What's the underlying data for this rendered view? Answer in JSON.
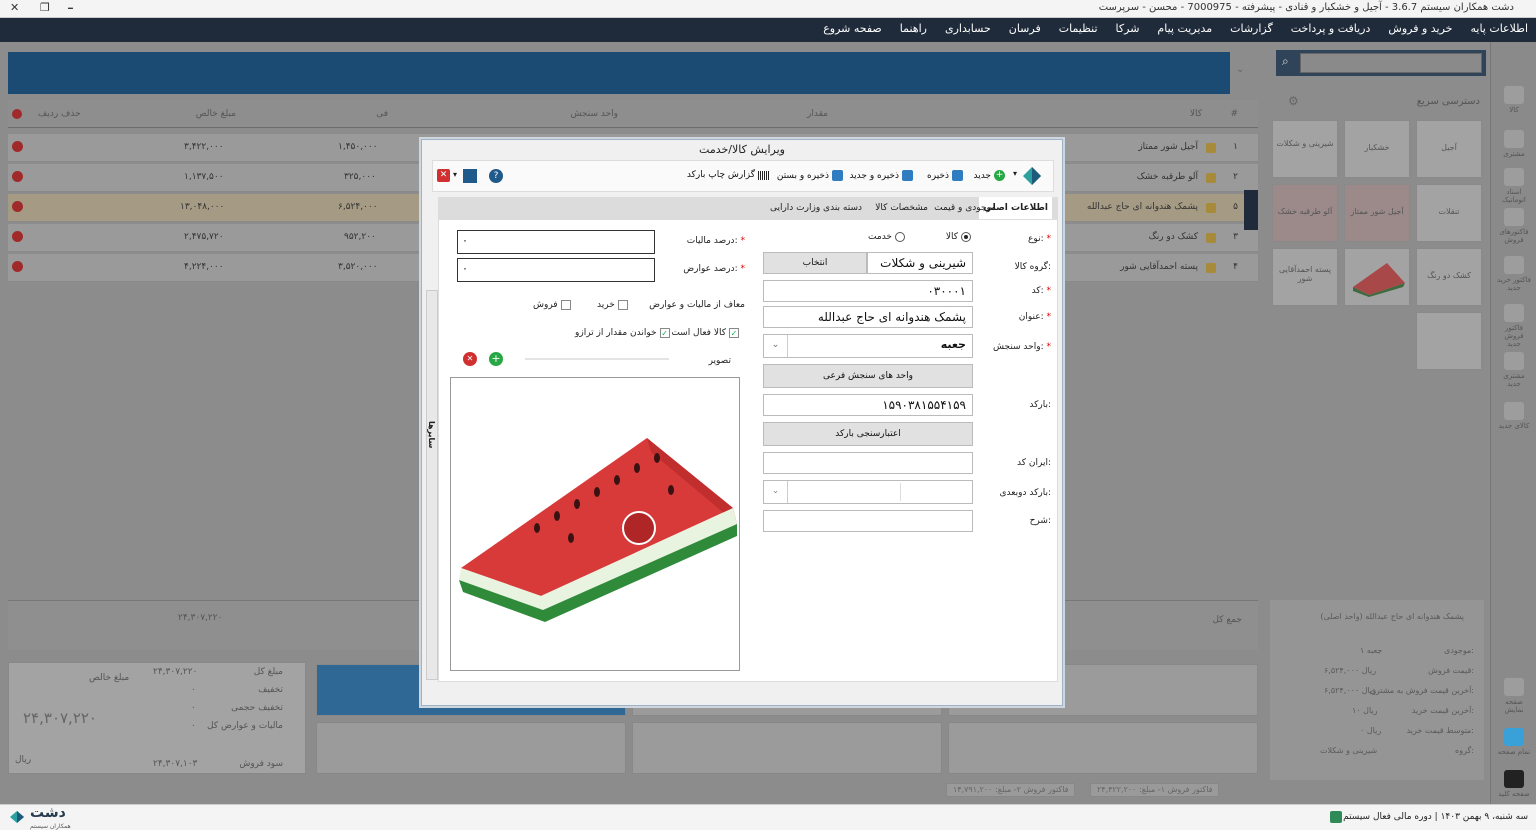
{
  "window": {
    "title": "دشت همکاران سیستم 3.6.7 - آجیل و خشکبار و قنادی - پیشرفته - 7000975 - محسن - سرپرست",
    "close": "✕",
    "restore": "❐",
    "minimize": "━"
  },
  "menu": [
    "اطلاعات پایه",
    "خرید و فروش",
    "دریافت و پرداخت",
    "گزارشات",
    "مدیریت پیام",
    "شرکا",
    "تنظیمات",
    "فرسان",
    "حسابداری",
    "راهنما",
    "صفحه شروع"
  ],
  "grid": {
    "headers": {
      "index": "#",
      "item": "کالا",
      "qty": "مقدار",
      "unit": "واحد سنجش",
      "fee": "فی",
      "net": "مبلغ خالص",
      "del": "حذف ردیف"
    },
    "rows": [
      {
        "index": "۱",
        "item": "آجیل شور ممتاز",
        "fee": "۱,۴۵۰,۰۰۰",
        "net": "۳,۴۲۲,۰۰۰"
      },
      {
        "index": "۲",
        "item": "آلو طرقبه خشک",
        "fee": "۳۲۵,۰۰۰",
        "net": "۱,۱۳۷,۵۰۰"
      },
      {
        "index": "۵",
        "item": "پشمک هندوانه ای حاج عبدالله",
        "fee": "۶,۵۲۴,۰۰۰",
        "net": "۱۳,۰۴۸,۰۰۰"
      },
      {
        "index": "۳",
        "item": "کشک دو رنگ",
        "fee": "۹۵۲,۲۰۰",
        "net": "۲,۴۷۵,۷۲۰"
      },
      {
        "index": "۴",
        "item": "پسته احمدآقایی شور",
        "fee": "۳,۵۲۰,۰۰۰",
        "net": "۴,۲۲۴,۰۰۰"
      }
    ]
  },
  "totals": {
    "label": "جمع کل",
    "value": "۲۴,۳۰۷,۲۲۰"
  },
  "summary": {
    "net_label": "مبلغ خالص",
    "net_value": "۲۴,۳۰۷,۲۲۰",
    "currency": "ریال",
    "gross_label": "مبلغ کل",
    "gross_value": "۲۴,۳۰۷,۲۲۰",
    "discount_label": "تخفیف",
    "discount_value": "۰",
    "volume_discount_label": "تخفیف حجمی",
    "volume_discount_value": "۰",
    "tax_label": "مالیات و عوارض کل",
    "tax_value": "۰",
    "profit_label": "سود فروش",
    "profit_value": "۲۴,۳۰۷,۱۰۳"
  },
  "factor_bar": [
    "فاکتور فروش ۱- مبلغ: ۲۴,۴۲۲,۲۰۰",
    "فاکتور فروش ۲- مبلغ: ۱۴,۷۹۱,۲۰۰"
  ],
  "quick_access": {
    "title": "دسترسی سریع",
    "tiles": [
      "آجیل",
      "خشکبار",
      "شیرینی و شکلات",
      "تنقلات",
      "آجیل شور ممتاز",
      "آلو طرقبه خشک",
      "کشک دو رنگ",
      "پسته احمدآقایی شور"
    ]
  },
  "product_info": {
    "header": "پشمک هندوانه ای حاج عبدالله (واحد اصلی)",
    "rows": [
      {
        "label": "موجودی:",
        "value": "۱ جعبه"
      },
      {
        "label": "قیمت فروش:",
        "value": "۶,۵۲۴,۰۰۰ ریال"
      },
      {
        "label": "آخرین قیمت فروش به مشتری:",
        "value": "۶,۵۲۴,۰۰۰ ریال"
      },
      {
        "label": "آخرین قیمت خرید:",
        "value": "۱۰ ریال"
      },
      {
        "label": "متوسط قیمت خرید:",
        "value": "۰ ریال"
      },
      {
        "label": "گروه:",
        "value": "شیرینی و شکلات"
      }
    ]
  },
  "sidebar": [
    "کالا",
    "مشتری",
    "اسناد اتوماتیک",
    "فاکتورهای فروش",
    "فاکتور خرید جدید",
    "فاکتور فروش جدید",
    "مشتری جدید",
    "کالای جدید",
    "صفحه نمایش",
    "تمام صفحه",
    "صفحه کلید"
  ],
  "status": {
    "logo": "دشت",
    "logo_sub": "همکاران سیستم",
    "text": "سه شنبه، ۹ بهمن ۱۴۰۳ | دوره مالی فعال سیستم"
  },
  "dialog": {
    "title": "ویرایش کالا/خدمت",
    "toolbar": {
      "new": "جدید",
      "save": "ذخیره",
      "save_new": "ذخیره و جدید",
      "save_close": "ذخیره و بستن",
      "barcode_report": "گزارش چاپ بارکد"
    },
    "tabs": [
      "اطلاعات اصلی",
      "موجودی و قیمت",
      "مشخصات کالا",
      "دسته بندی وزارت دارایی"
    ],
    "side_tab": "سایرها",
    "form": {
      "type_label": "نوع:",
      "type_goods": "کالا",
      "type_service": "خدمت",
      "group_label": "گروه کالا:",
      "group_value": "شیرینی و شکلات",
      "group_btn": "انتخاب",
      "code_label": "کد:",
      "code_value": "۰۳۰۰۰۱",
      "title_label": "عنوان:",
      "title_value": "پشمک هندوانه ای حاج عبدالله",
      "unit_label": "واحد سنجش:",
      "unit_value": "جعبه",
      "subunits_btn": "واحد های سنجش فرعی",
      "barcode_label": "بارکد:",
      "barcode_value": "۱۵۹۰۳۸۱۵۵۴۱۵۹",
      "barcode_check_btn": "اعتبارسنجی بارکد",
      "iran_code_label": "ایران کد:",
      "iran_code_value": "",
      "barcode2d_label": "بارکد دوبعدی:",
      "desc_label": "شرح:",
      "desc_value": "",
      "tax_label": "درصد مالیات:",
      "tax_value": "۰",
      "duty_label": "درصد عوارض:",
      "duty_value": "۰",
      "exempt_label": "معاف از مالیات و عوارض",
      "exempt_buy": "خرید",
      "exempt_sell": "فروش",
      "active_label": "کالا فعال است",
      "scale_label": "خواندن مقدار از ترازو",
      "image_label": "تصویر"
    }
  },
  "colors": {
    "menubar": "#1f2b3a",
    "accent": "#1b4a72",
    "tab_active": "#222"
  }
}
